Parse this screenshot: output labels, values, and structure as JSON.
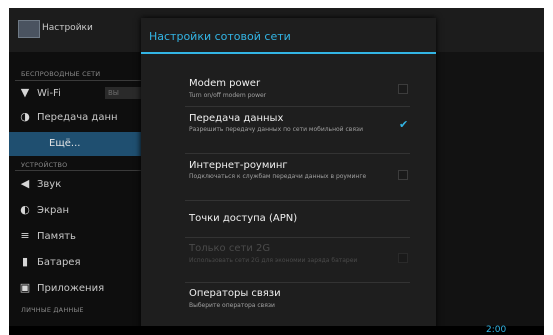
{
  "app": {
    "title": "Настройки"
  },
  "sidebar": {
    "header_wireless": "БЕСПРОВОДНЫЕ СЕТИ",
    "header_device": "УСТРОЙСТВО",
    "header_personal": "ЛИЧНЫЕ ДАННЫЕ",
    "wifi_badge": "ВЫ",
    "items": [
      {
        "label": "Wi-Fi",
        "icon": "wifi-icon"
      },
      {
        "label": "Передача данн",
        "icon": "data-usage-icon"
      },
      {
        "label": "Ещё...",
        "icon": ""
      },
      {
        "label": "Звук",
        "icon": "sound-icon"
      },
      {
        "label": "Экран",
        "icon": "display-icon"
      },
      {
        "label": "Память",
        "icon": "storage-icon"
      },
      {
        "label": "Батарея",
        "icon": "battery-icon"
      },
      {
        "label": "Приложения",
        "icon": "apps-icon"
      }
    ]
  },
  "dialog": {
    "title": "Настройки сотовой сети",
    "options": [
      {
        "title": "Modem power",
        "summary": "Turn on/off modem power",
        "checked": false,
        "enabled": true
      },
      {
        "title": "Передача данных",
        "summary": "Разрешить передачу данных по сети мобильной связи",
        "checked": true,
        "enabled": true
      },
      {
        "title": "Интернет-роуминг",
        "summary": "Подключаться к службам передачи данных в роуминге",
        "checked": false,
        "enabled": true
      },
      {
        "title": "Точки доступа (APN)",
        "summary": "",
        "enabled": true
      },
      {
        "title": "Только сети 2G",
        "summary": "Использовать сети 2G для экономии заряда батареи",
        "checked": false,
        "enabled": false
      },
      {
        "title": "Операторы связи",
        "summary": "Выберите оператора связи",
        "enabled": true
      }
    ]
  },
  "status": {
    "time": "2:00"
  },
  "colors": {
    "accent": "#33b5e5",
    "selected": "#1f4f70"
  }
}
